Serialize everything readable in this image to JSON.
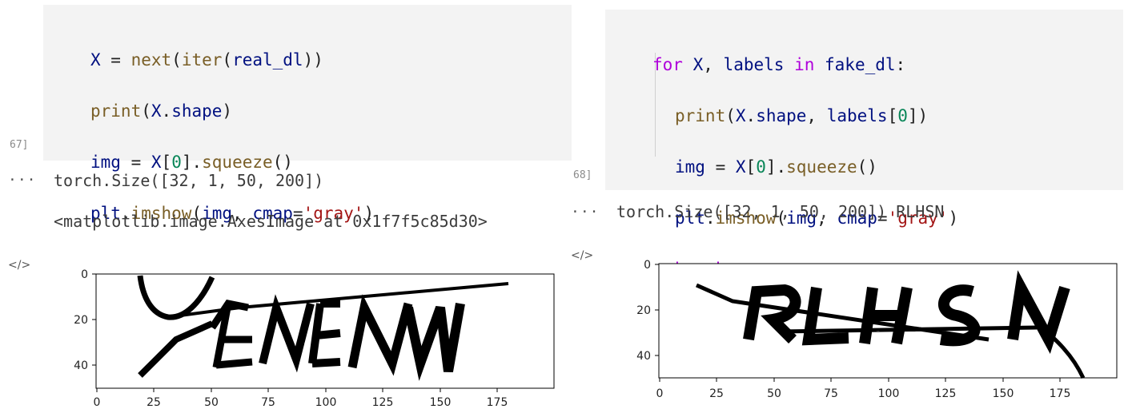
{
  "left_cell": {
    "execution_count": "67]",
    "code": {
      "line1": {
        "a": "X",
        "b": " = ",
        "c": "next",
        "d": "(",
        "e": "iter",
        "f": "(",
        "g": "real_dl",
        "h": "))"
      },
      "line2": {
        "a": "print",
        "b": "(",
        "c": "X",
        "d": ".",
        "e": "shape",
        "f": ")"
      },
      "line3": {
        "a": "img",
        "b": " = ",
        "c": "X",
        "d": "[",
        "e": "0",
        "f": "].",
        "g": "squeeze",
        "h": "()"
      },
      "line4": {
        "a": "plt",
        "b": ".",
        "c": "imshow",
        "d": "(",
        "e": "img",
        "f": ", ",
        "g": "cmap",
        "h": "=",
        "i": "'gray'",
        "j": ")"
      }
    },
    "output_menu": "···",
    "output_line1": "torch.Size([32, 1, 50, 200])",
    "output_line2": "<matplotlib.image.AxesImage at 0x1f7f5c85d30>",
    "output_icon": "</>",
    "plot": {
      "x_ticks": [
        "0",
        "25",
        "50",
        "75",
        "100",
        "125",
        "150",
        "175"
      ],
      "y_ticks": [
        "0",
        "20",
        "40"
      ],
      "image_text": "ENENN"
    }
  },
  "right_cell": {
    "execution_count": "68]",
    "code": {
      "line1": {
        "a": "for",
        "b": " ",
        "c": "X",
        "d": ", ",
        "e": "labels",
        "f": " ",
        "g": "in",
        "h": " ",
        "i": "fake_dl",
        "j": ":"
      },
      "line2": {
        "a": "print",
        "b": "(",
        "c": "X",
        "d": ".",
        "e": "shape",
        "f": ", ",
        "g": "labels",
        "h": "[",
        "i": "0",
        "j": "])"
      },
      "line3": {
        "a": "img",
        "b": " = ",
        "c": "X",
        "d": "[",
        "e": "0",
        "f": "].",
        "g": "squeeze",
        "h": "()"
      },
      "line4": {
        "a": "plt",
        "b": ".",
        "c": "imshow",
        "d": "(",
        "e": "img",
        "f": ", ",
        "g": "cmap",
        "h": "=",
        "i": "'gray'",
        "j": ")"
      },
      "line5": {
        "a": "break"
      }
    },
    "output_menu": "···",
    "output_line1": "torch.Size([32, 1, 50, 200]) RLHSN",
    "output_icon": "</>",
    "plot": {
      "x_ticks": [
        "0",
        "25",
        "50",
        "75",
        "100",
        "125",
        "150",
        "175"
      ],
      "y_ticks": [
        "0",
        "20",
        "40"
      ],
      "image_text": "RLHSN"
    }
  },
  "colors": {
    "keyword": "#af00db",
    "function": "#795e26",
    "variable": "#001080",
    "number": "#098658",
    "string": "#a31515",
    "cell_background": "#f3f3f3"
  }
}
